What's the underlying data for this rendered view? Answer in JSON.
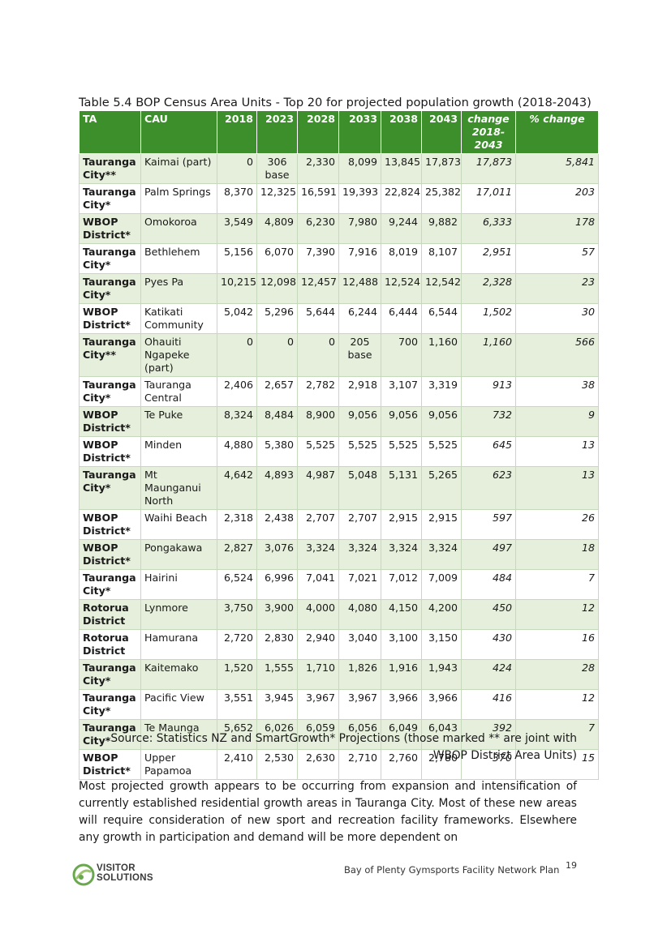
{
  "caption": "Table 5.4 BOP Census Area Units - Top 20 for projected population growth (2018-2043)",
  "headers": [
    "TA",
    "CAU",
    "2018",
    "2023",
    "2028",
    "2033",
    "2038",
    "2043",
    "change 2018-2043",
    "% change"
  ],
  "rows": [
    [
      "Tauranga City**",
      "Kaimai (part)",
      "0",
      "306 base",
      "2,330",
      "8,099",
      "13,845",
      "17,873",
      "17,873",
      "5,841"
    ],
    [
      "Tauranga City*",
      "Palm Springs",
      "8,370",
      "12,325",
      "16,591",
      "19,393",
      "22,824",
      "25,382",
      "17,011",
      "203"
    ],
    [
      "WBOP District*",
      "Omokoroa",
      "3,549",
      "4,809",
      "6,230",
      "7,980",
      "9,244",
      "9,882",
      "6,333",
      "178"
    ],
    [
      "Tauranga City*",
      "Bethlehem",
      "5,156",
      "6,070",
      "7,390",
      "7,916",
      "8,019",
      "8,107",
      "2,951",
      "57"
    ],
    [
      "Tauranga City*",
      "Pyes Pa",
      "10,215",
      "12,098",
      "12,457",
      "12,488",
      "12,524",
      "12,542",
      "2,328",
      "23"
    ],
    [
      "WBOP District*",
      "Katikati Community",
      "5,042",
      "5,296",
      "5,644",
      "6,244",
      "6,444",
      "6,544",
      "1,502",
      "30"
    ],
    [
      "Tauranga City**",
      "Ohauiti Ngapeke (part)",
      "0",
      "0",
      "0",
      "205 base",
      "700",
      "1,160",
      "1,160",
      "566"
    ],
    [
      "Tauranga City*",
      "Tauranga Central",
      "2,406",
      "2,657",
      "2,782",
      "2,918",
      "3,107",
      "3,319",
      "913",
      "38"
    ],
    [
      "WBOP District*",
      "Te Puke",
      "8,324",
      "8,484",
      "8,900",
      "9,056",
      "9,056",
      "9,056",
      "732",
      "9"
    ],
    [
      "WBOP District*",
      "Minden",
      "4,880",
      "5,380",
      "5,525",
      "5,525",
      "5,525",
      "5,525",
      "645",
      "13"
    ],
    [
      "Tauranga City*",
      "Mt Maunganui North",
      "4,642",
      "4,893",
      "4,987",
      "5,048",
      "5,131",
      "5,265",
      "623",
      "13"
    ],
    [
      "WBOP District*",
      "Waihi Beach",
      "2,318",
      "2,438",
      "2,707",
      "2,707",
      "2,915",
      "2,915",
      "597",
      "26"
    ],
    [
      "WBOP District*",
      "Pongakawa",
      "2,827",
      "3,076",
      "3,324",
      "3,324",
      "3,324",
      "3,324",
      "497",
      "18"
    ],
    [
      "Tauranga City*",
      "Hairini",
      "6,524",
      "6,996",
      "7,041",
      "7,021",
      "7,012",
      "7,009",
      "484",
      "7"
    ],
    [
      "Rotorua District",
      "Lynmore",
      "3,750",
      "3,900",
      "4,000",
      "4,080",
      "4,150",
      "4,200",
      "450",
      "12"
    ],
    [
      "Rotorua District",
      "Hamurana",
      "2,720",
      "2,830",
      "2,940",
      "3,040",
      "3,100",
      "3,150",
      "430",
      "16"
    ],
    [
      "Tauranga City*",
      "Kaitemako",
      "1,520",
      "1,555",
      "1,710",
      "1,826",
      "1,916",
      "1,943",
      "424",
      "28"
    ],
    [
      "Tauranga City*",
      "Pacific View",
      "3,551",
      "3,945",
      "3,967",
      "3,967",
      "3,966",
      "3,966",
      "416",
      "12"
    ],
    [
      "Tauranga City*",
      "Te Maunga",
      "5,652",
      "6,026",
      "6,059",
      "6,056",
      "6,049",
      "6,043",
      "392",
      "7"
    ],
    [
      "WBOP District*",
      "Upper Papamoa",
      "2,410",
      "2,530",
      "2,630",
      "2,710",
      "2,760",
      "2,780",
      "370",
      "15"
    ]
  ],
  "source": "Source: Statistics NZ and SmartGrowth* Projections (those marked ** are joint with WBOP District Area Units)",
  "paragraph": "Most projected growth appears to be occurring from expansion and intensification of currently established residential growth areas in Tauranga City. Most of these new areas will require consideration of new sport and recreation facility frameworks. Elsewhere any growth in participation and demand will be more dependent on",
  "footer": {
    "logo_line1": "VISITOR",
    "logo_line2": "SOLUTIONS",
    "document_title": "Bay of Plenty Gymsports Facility Network Plan",
    "page_number": "19"
  },
  "colors": {
    "header_green": "#3c8f2b",
    "row_tint": "#e6efdc",
    "logo_green": "#6aa84f"
  }
}
